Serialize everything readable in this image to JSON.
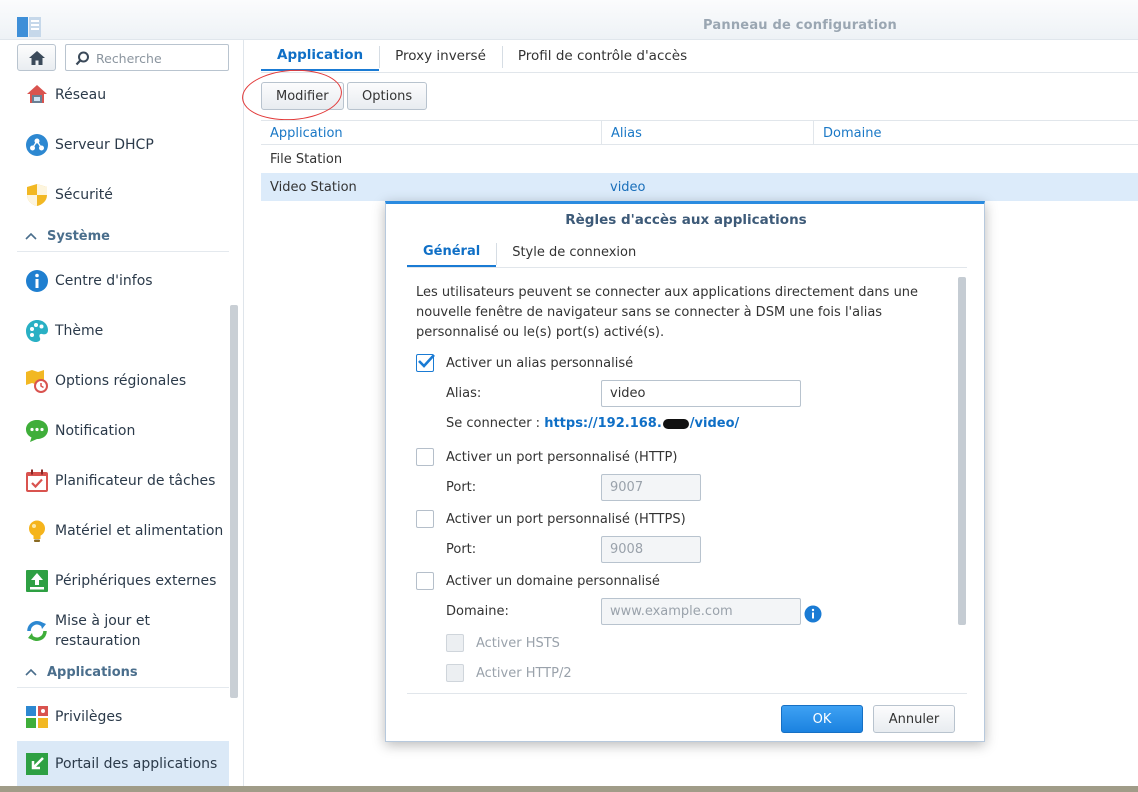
{
  "window": {
    "title": "Panneau de configuration"
  },
  "search": {
    "placeholder": "Recherche"
  },
  "sidebar": {
    "items": [
      {
        "label": "Réseau"
      },
      {
        "label": "Serveur DHCP"
      },
      {
        "label": "Sécurité"
      }
    ],
    "section_system": "Système",
    "system_items": [
      {
        "label": "Centre d'infos"
      },
      {
        "label": "Thème"
      },
      {
        "label": "Options régionales"
      },
      {
        "label": "Notification"
      },
      {
        "label": "Planificateur de tâches"
      },
      {
        "label": "Matériel et alimentation"
      },
      {
        "label": "Périphériques externes"
      },
      {
        "label": "Mise à jour et restauration"
      }
    ],
    "section_apps": "Applications",
    "app_items": [
      {
        "label": "Privilèges"
      },
      {
        "label": "Portail des applications"
      }
    ]
  },
  "main": {
    "tabs": [
      "Application",
      "Proxy inversé",
      "Profil de contrôle d'accès"
    ],
    "toolbar": {
      "modify": "Modifier",
      "options": "Options"
    },
    "table": {
      "columns": [
        "Application",
        "Alias",
        "Domaine"
      ],
      "rows": [
        {
          "application": "File Station",
          "alias": "",
          "domain": ""
        },
        {
          "application": "Video Station",
          "alias": "video",
          "domain": ""
        }
      ]
    }
  },
  "dialog": {
    "title": "Règles d'accès aux applications",
    "tabs": [
      "Général",
      "Style de connexion"
    ],
    "description": "Les utilisateurs peuvent se connecter aux applications directement dans une nouvelle fenêtre de navigateur sans se connecter à DSM une fois l'alias personnalisé ou le(s) port(s) activé(s).",
    "alias_check": "Activer un alias personnalisé",
    "alias_label": "Alias:",
    "alias_value": "video",
    "connect_label": "Se connecter :",
    "connect_url_start": "https://192.168.",
    "connect_url_end": "/video/",
    "http_check": "Activer un port personnalisé (HTTP)",
    "http_port_label": "Port:",
    "http_port": "9007",
    "https_check": "Activer un port personnalisé (HTTPS)",
    "https_port_label": "Port:",
    "https_port": "9008",
    "domain_check": "Activer un domaine personnalisé",
    "domain_label": "Domaine:",
    "domain_placeholder": "www.example.com",
    "hsts_check": "Activer HSTS",
    "http2_check": "Activer HTTP/2",
    "ok": "OK",
    "cancel": "Annuler"
  },
  "colors": {
    "accent": "#1a7bd4",
    "annotation": "#e23a3a",
    "selected_row": "#dcebfa"
  }
}
